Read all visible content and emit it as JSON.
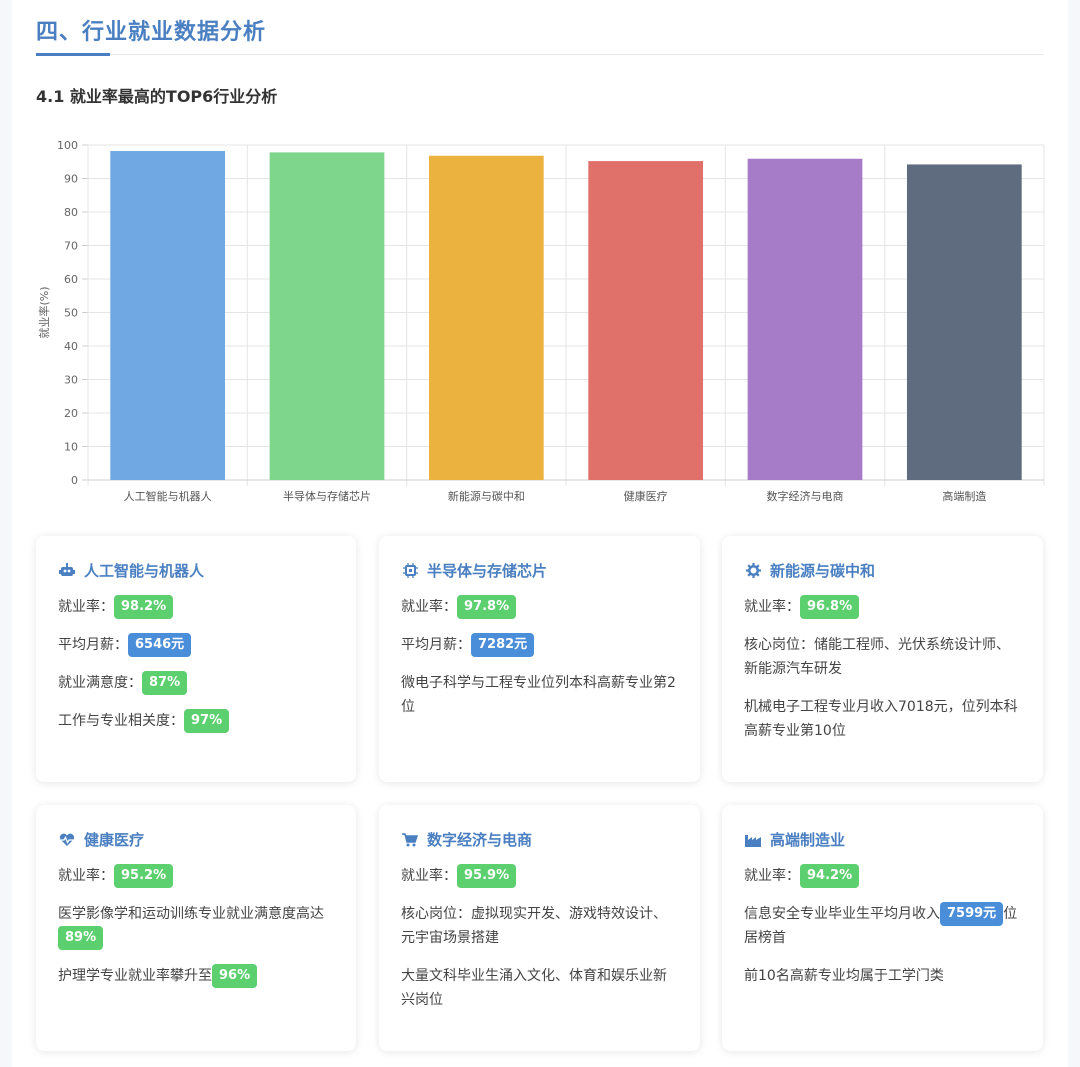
{
  "section": {
    "title": "四、行业就业数据分析"
  },
  "subsection": {
    "title": "4.1 就业率最高的TOP6行业分析"
  },
  "chart_data": {
    "type": "bar",
    "categories": [
      "人工智能与机器人",
      "半导体与存储芯片",
      "新能源与碳中和",
      "健康医疗",
      "数字经济与电商",
      "高端制造"
    ],
    "values": [
      98.2,
      97.8,
      96.8,
      95.2,
      95.9,
      94.2
    ],
    "colors": [
      "#6fa8e3",
      "#7dd68b",
      "#ebb23f",
      "#e0706a",
      "#a67bc8",
      "#5f6b7f"
    ],
    "ylabel": "就业率(%)",
    "ylim": [
      0,
      100
    ],
    "yticks": [
      0,
      10,
      20,
      30,
      40,
      50,
      60,
      70,
      80,
      90,
      100
    ],
    "grid": true
  },
  "cards": [
    {
      "title": "人工智能与机器人",
      "icon": "robot-icon",
      "rows": [
        {
          "pre": "就业率：",
          "badge": "98.2%",
          "badge_color": "green",
          "post": ""
        },
        {
          "pre": "平均月薪：",
          "badge": "6546元",
          "badge_color": "blue",
          "post": ""
        },
        {
          "pre": "就业满意度：",
          "badge": "87%",
          "badge_color": "green",
          "post": ""
        },
        {
          "pre": "工作与专业相关度：",
          "badge": "97%",
          "badge_color": "green",
          "post": ""
        }
      ]
    },
    {
      "title": "半导体与存储芯片",
      "icon": "chip-icon",
      "rows": [
        {
          "pre": "就业率：",
          "badge": "97.8%",
          "badge_color": "green",
          "post": ""
        },
        {
          "pre": "平均月薪：",
          "badge": "7282元",
          "badge_color": "blue",
          "post": ""
        },
        {
          "pre": "微电子科学与工程专业位列本科高薪专业第2位",
          "badge": "",
          "badge_color": "",
          "post": ""
        }
      ]
    },
    {
      "title": "新能源与碳中和",
      "icon": "gear-icon",
      "rows": [
        {
          "pre": "就业率：",
          "badge": "96.8%",
          "badge_color": "green",
          "post": ""
        },
        {
          "pre": "核心岗位：储能工程师、光伏系统设计师、新能源汽车研发",
          "badge": "",
          "badge_color": "",
          "post": ""
        },
        {
          "pre": "机械电子工程专业月收入7018元，位列本科高薪专业第10位",
          "badge": "",
          "badge_color": "",
          "post": ""
        }
      ]
    },
    {
      "title": "健康医疗",
      "icon": "heartbeat-icon",
      "rows": [
        {
          "pre": "就业率：",
          "badge": "95.2%",
          "badge_color": "green",
          "post": ""
        },
        {
          "pre": "医学影像学和运动训练专业就业满意度高达",
          "badge": "89%",
          "badge_color": "green",
          "post": ""
        },
        {
          "pre": "护理学专业就业率攀升至",
          "badge": "96%",
          "badge_color": "green",
          "post": ""
        }
      ]
    },
    {
      "title": "数字经济与电商",
      "icon": "cart-icon",
      "rows": [
        {
          "pre": "就业率：",
          "badge": "95.9%",
          "badge_color": "green",
          "post": ""
        },
        {
          "pre": "核心岗位：虚拟现实开发、游戏特效设计、元宇宙场景搭建",
          "badge": "",
          "badge_color": "",
          "post": ""
        },
        {
          "pre": "大量文科毕业生涌入文化、体育和娱乐业新兴岗位",
          "badge": "",
          "badge_color": "",
          "post": ""
        }
      ]
    },
    {
      "title": "高端制造业",
      "icon": "factory-icon",
      "rows": [
        {
          "pre": "就业率：",
          "badge": "94.2%",
          "badge_color": "green",
          "post": ""
        },
        {
          "pre": "信息安全专业毕业生平均月收入",
          "badge": "7599元",
          "badge_color": "blue",
          "post": "位居榜首"
        },
        {
          "pre": "前10名高薪专业均属于工学门类",
          "badge": "",
          "badge_color": "",
          "post": ""
        }
      ]
    }
  ]
}
